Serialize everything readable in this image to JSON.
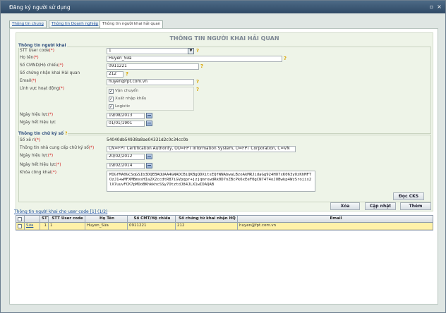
{
  "window": {
    "title": "Đăng ký người sử dụng",
    "minimize_glyph": "▫",
    "close_glyph": "×"
  },
  "tabs": [
    {
      "label": "Thông tin chung"
    },
    {
      "label": "Thông tin Doanh nghiệp"
    },
    {
      "label": "Thông tin người khai hải quan"
    }
  ],
  "form": {
    "heading": "THÔNG TIN NGƯỜI KHAI HẢI QUAN",
    "section_declarant": {
      "legend": "Thông tin người khai",
      "stt_user_code": {
        "label": "STT User code",
        "value": "1"
      },
      "full_name": {
        "label": "Họ tên",
        "value": "Huyen_Sửa"
      },
      "id_passport": {
        "label": "Số CMND/Hộ chiếu",
        "value": "0911221"
      },
      "customs_cert_no": {
        "label": "Số chứng nhận khai Hải quan",
        "value": "212"
      },
      "email": {
        "label": "Email",
        "value": "huyen@fpt.com.vn"
      },
      "operation_field": {
        "label": "Lĩnh vực hoạt động",
        "options": [
          {
            "label": "Vận chuyển",
            "checked": true
          },
          {
            "label": "Xuất nhập khẩu",
            "checked": true
          },
          {
            "label": "Logistic",
            "checked": true
          }
        ]
      },
      "effective_date": {
        "label": "Ngày hiệu lực",
        "value": "19/08/2013"
      },
      "expiry_date": {
        "label": "Ngày hết hiệu lực",
        "value": "01/01/1901"
      }
    },
    "section_signature": {
      "legend": "Thông tin chữ ký số",
      "serial_no": {
        "label": "Số xê ri",
        "value": "54040db54938a8ae04331d2c0c34cc0b"
      },
      "ca_provider": {
        "label": "Thông tin nhà cung cấp chữ ký số",
        "value": "CN=FPT Certification Authority, OU=FPT Information System, O=FPT Corporation, C=VN"
      },
      "effective_date": {
        "label": "Ngày hiệu lực",
        "value": "20/02/2012"
      },
      "expiry_date": {
        "label": "Ngày hết hiệu lực",
        "value": "19/02/2014"
      },
      "public_key": {
        "label": "Khóa công khai",
        "value": "MIGfMA0GCSqGSIb3DQEBAQUAA4GNADCBiQKBgQDXitsEQfWNAbwaLBzoAkMRJidaGg924HO7xK063yOzKhMFTOzJ1+wMFXMBmxsHIa2X2ccdtR87iGVpqpr+jzjqmrxwdRk0D7nZBcPk6xEeF0gCN74T4oJOBwkp4WzSrojix2lX7uuvFCK7pMOoBKhkkhcSSy7OtztdJ84JLX1wIDAQAB"
      }
    },
    "read_cks_button": "Đọc CKS",
    "actions": {
      "delete": "Xóa",
      "update": "Cập nhật",
      "add": "Thêm"
    }
  },
  "list": {
    "caption": "Thông tin người khai cho user code [1] (1/2)",
    "columns": [
      "",
      "STT",
      "STT User code",
      "Họ Tên",
      "Số CMT/Hộ chiếu",
      "Số chứng từ khai nhận HQ",
      "Email"
    ],
    "rows": [
      {
        "action": "Sửa",
        "stt": "1",
        "user_code": "1",
        "name": "Huyen_Sửa",
        "id_no": "0911221",
        "cert_no": "212",
        "email": "huyen@fpt.com.vn"
      }
    ]
  },
  "colors": {
    "titlebar": "#34506d",
    "form_bg": "#eef4e8",
    "row_highlight": "#fff1a8",
    "required": "#d21f1f"
  }
}
